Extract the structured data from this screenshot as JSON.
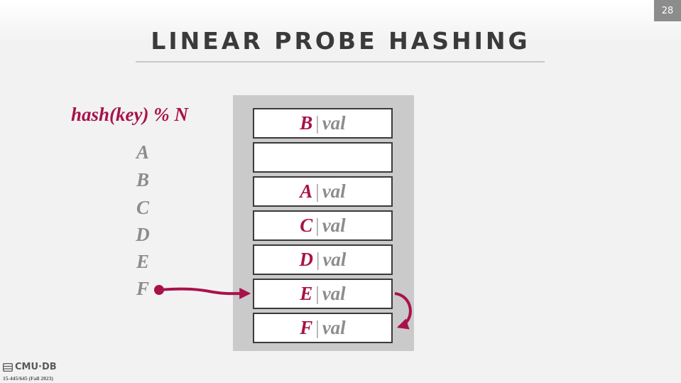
{
  "page_number": "28",
  "title": "LINEAR PROBE HASHING",
  "hash_formula": "hash(key) % N",
  "keys": [
    "A",
    "B",
    "C",
    "D",
    "E",
    "F"
  ],
  "slots": [
    {
      "key": "B",
      "sep": "|",
      "val": "val"
    },
    {
      "key": "",
      "sep": "",
      "val": ""
    },
    {
      "key": "A",
      "sep": "|",
      "val": "val"
    },
    {
      "key": "C",
      "sep": "|",
      "val": "val"
    },
    {
      "key": "D",
      "sep": "|",
      "val": "val"
    },
    {
      "key": "E",
      "sep": "|",
      "val": "val"
    },
    {
      "key": "F",
      "sep": "|",
      "val": "val"
    }
  ],
  "footer": {
    "logo_text": "CMU·DB",
    "course": "15-445/645 (Fall 2023)"
  },
  "colors": {
    "accent": "#a8124a",
    "muted": "#8c8c8c",
    "table_background": "#cacaca"
  }
}
